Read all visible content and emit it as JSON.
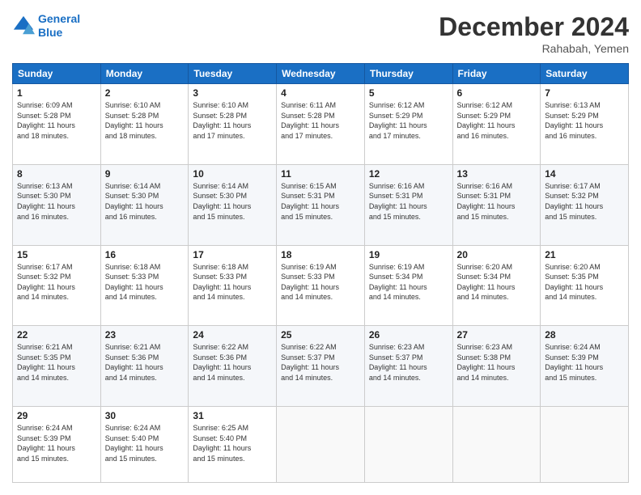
{
  "header": {
    "logo_line1": "General",
    "logo_line2": "Blue",
    "month": "December 2024",
    "location": "Rahabah, Yemen"
  },
  "weekdays": [
    "Sunday",
    "Monday",
    "Tuesday",
    "Wednesday",
    "Thursday",
    "Friday",
    "Saturday"
  ],
  "rows": [
    [
      {
        "day": "1",
        "lines": [
          "Sunrise: 6:09 AM",
          "Sunset: 5:28 PM",
          "Daylight: 11 hours",
          "and 18 minutes."
        ]
      },
      {
        "day": "2",
        "lines": [
          "Sunrise: 6:10 AM",
          "Sunset: 5:28 PM",
          "Daylight: 11 hours",
          "and 18 minutes."
        ]
      },
      {
        "day": "3",
        "lines": [
          "Sunrise: 6:10 AM",
          "Sunset: 5:28 PM",
          "Daylight: 11 hours",
          "and 17 minutes."
        ]
      },
      {
        "day": "4",
        "lines": [
          "Sunrise: 6:11 AM",
          "Sunset: 5:28 PM",
          "Daylight: 11 hours",
          "and 17 minutes."
        ]
      },
      {
        "day": "5",
        "lines": [
          "Sunrise: 6:12 AM",
          "Sunset: 5:29 PM",
          "Daylight: 11 hours",
          "and 17 minutes."
        ]
      },
      {
        "day": "6",
        "lines": [
          "Sunrise: 6:12 AM",
          "Sunset: 5:29 PM",
          "Daylight: 11 hours",
          "and 16 minutes."
        ]
      },
      {
        "day": "7",
        "lines": [
          "Sunrise: 6:13 AM",
          "Sunset: 5:29 PM",
          "Daylight: 11 hours",
          "and 16 minutes."
        ]
      }
    ],
    [
      {
        "day": "8",
        "lines": [
          "Sunrise: 6:13 AM",
          "Sunset: 5:30 PM",
          "Daylight: 11 hours",
          "and 16 minutes."
        ]
      },
      {
        "day": "9",
        "lines": [
          "Sunrise: 6:14 AM",
          "Sunset: 5:30 PM",
          "Daylight: 11 hours",
          "and 16 minutes."
        ]
      },
      {
        "day": "10",
        "lines": [
          "Sunrise: 6:14 AM",
          "Sunset: 5:30 PM",
          "Daylight: 11 hours",
          "and 15 minutes."
        ]
      },
      {
        "day": "11",
        "lines": [
          "Sunrise: 6:15 AM",
          "Sunset: 5:31 PM",
          "Daylight: 11 hours",
          "and 15 minutes."
        ]
      },
      {
        "day": "12",
        "lines": [
          "Sunrise: 6:16 AM",
          "Sunset: 5:31 PM",
          "Daylight: 11 hours",
          "and 15 minutes."
        ]
      },
      {
        "day": "13",
        "lines": [
          "Sunrise: 6:16 AM",
          "Sunset: 5:31 PM",
          "Daylight: 11 hours",
          "and 15 minutes."
        ]
      },
      {
        "day": "14",
        "lines": [
          "Sunrise: 6:17 AM",
          "Sunset: 5:32 PM",
          "Daylight: 11 hours",
          "and 15 minutes."
        ]
      }
    ],
    [
      {
        "day": "15",
        "lines": [
          "Sunrise: 6:17 AM",
          "Sunset: 5:32 PM",
          "Daylight: 11 hours",
          "and 14 minutes."
        ]
      },
      {
        "day": "16",
        "lines": [
          "Sunrise: 6:18 AM",
          "Sunset: 5:33 PM",
          "Daylight: 11 hours",
          "and 14 minutes."
        ]
      },
      {
        "day": "17",
        "lines": [
          "Sunrise: 6:18 AM",
          "Sunset: 5:33 PM",
          "Daylight: 11 hours",
          "and 14 minutes."
        ]
      },
      {
        "day": "18",
        "lines": [
          "Sunrise: 6:19 AM",
          "Sunset: 5:33 PM",
          "Daylight: 11 hours",
          "and 14 minutes."
        ]
      },
      {
        "day": "19",
        "lines": [
          "Sunrise: 6:19 AM",
          "Sunset: 5:34 PM",
          "Daylight: 11 hours",
          "and 14 minutes."
        ]
      },
      {
        "day": "20",
        "lines": [
          "Sunrise: 6:20 AM",
          "Sunset: 5:34 PM",
          "Daylight: 11 hours",
          "and 14 minutes."
        ]
      },
      {
        "day": "21",
        "lines": [
          "Sunrise: 6:20 AM",
          "Sunset: 5:35 PM",
          "Daylight: 11 hours",
          "and 14 minutes."
        ]
      }
    ],
    [
      {
        "day": "22",
        "lines": [
          "Sunrise: 6:21 AM",
          "Sunset: 5:35 PM",
          "Daylight: 11 hours",
          "and 14 minutes."
        ]
      },
      {
        "day": "23",
        "lines": [
          "Sunrise: 6:21 AM",
          "Sunset: 5:36 PM",
          "Daylight: 11 hours",
          "and 14 minutes."
        ]
      },
      {
        "day": "24",
        "lines": [
          "Sunrise: 6:22 AM",
          "Sunset: 5:36 PM",
          "Daylight: 11 hours",
          "and 14 minutes."
        ]
      },
      {
        "day": "25",
        "lines": [
          "Sunrise: 6:22 AM",
          "Sunset: 5:37 PM",
          "Daylight: 11 hours",
          "and 14 minutes."
        ]
      },
      {
        "day": "26",
        "lines": [
          "Sunrise: 6:23 AM",
          "Sunset: 5:37 PM",
          "Daylight: 11 hours",
          "and 14 minutes."
        ]
      },
      {
        "day": "27",
        "lines": [
          "Sunrise: 6:23 AM",
          "Sunset: 5:38 PM",
          "Daylight: 11 hours",
          "and 14 minutes."
        ]
      },
      {
        "day": "28",
        "lines": [
          "Sunrise: 6:24 AM",
          "Sunset: 5:39 PM",
          "Daylight: 11 hours",
          "and 15 minutes."
        ]
      }
    ],
    [
      {
        "day": "29",
        "lines": [
          "Sunrise: 6:24 AM",
          "Sunset: 5:39 PM",
          "Daylight: 11 hours",
          "and 15 minutes."
        ]
      },
      {
        "day": "30",
        "lines": [
          "Sunrise: 6:24 AM",
          "Sunset: 5:40 PM",
          "Daylight: 11 hours",
          "and 15 minutes."
        ]
      },
      {
        "day": "31",
        "lines": [
          "Sunrise: 6:25 AM",
          "Sunset: 5:40 PM",
          "Daylight: 11 hours",
          "and 15 minutes."
        ]
      },
      null,
      null,
      null,
      null
    ]
  ]
}
